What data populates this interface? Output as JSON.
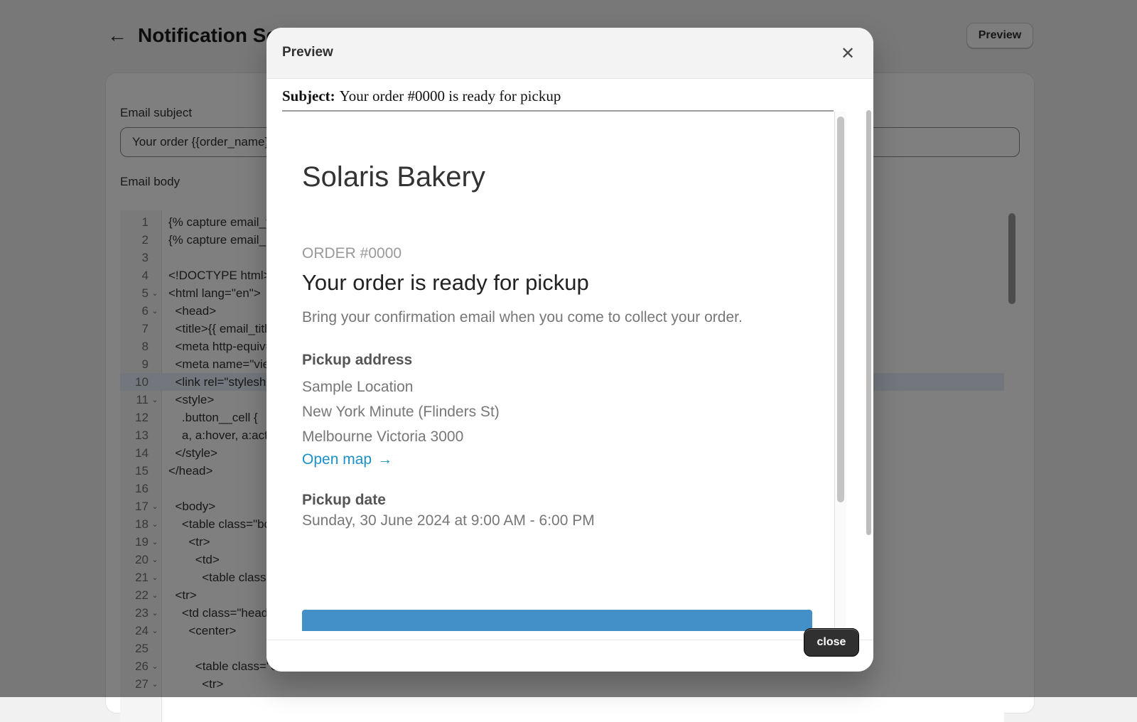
{
  "page": {
    "title": "Notification Settings",
    "preview_label": "Preview",
    "subject_label": "Email subject",
    "subject_value": "Your order {{order_name}} is ready for pickup",
    "body_label": "Email body"
  },
  "code_lines": [
    {
      "n": "1",
      "fold": "",
      "text": "{% capture email_title %}"
    },
    {
      "n": "2",
      "fold": "",
      "text": "{% capture email_body %}"
    },
    {
      "n": "3",
      "fold": "",
      "text": ""
    },
    {
      "n": "4",
      "fold": "",
      "text": "<!DOCTYPE html>"
    },
    {
      "n": "5",
      "fold": "⌄",
      "text": "<html lang=\"en\">"
    },
    {
      "n": "6",
      "fold": "⌄",
      "text": "  <head>"
    },
    {
      "n": "7",
      "fold": "",
      "text": "  <title>{{ email_title }}</title>"
    },
    {
      "n": "8",
      "fold": "",
      "text": "  <meta http-equiv=\"Content-Type\">"
    },
    {
      "n": "9",
      "fold": "",
      "text": "  <meta name=\"viewport\">"
    },
    {
      "n": "10",
      "fold": "",
      "text": "  <link rel=\"stylesheet\">"
    },
    {
      "n": "11",
      "fold": "⌄",
      "text": "  <style>"
    },
    {
      "n": "12",
      "fold": "",
      "text": "    .button__cell {"
    },
    {
      "n": "13",
      "fold": "",
      "text": "    a, a:hover, a:active"
    },
    {
      "n": "14",
      "fold": "",
      "text": "  </style>"
    },
    {
      "n": "15",
      "fold": "",
      "text": "</head>"
    },
    {
      "n": "16",
      "fold": "",
      "text": ""
    },
    {
      "n": "17",
      "fold": "⌄",
      "text": "  <body>"
    },
    {
      "n": "18",
      "fold": "⌄",
      "text": "    <table class=\"body\">"
    },
    {
      "n": "19",
      "fold": "⌄",
      "text": "      <tr>"
    },
    {
      "n": "20",
      "fold": "⌄",
      "text": "        <td>"
    },
    {
      "n": "21",
      "fold": "⌄",
      "text": "          <table class=\"header\">"
    },
    {
      "n": "22",
      "fold": "⌄",
      "text": "  <tr>"
    },
    {
      "n": "23",
      "fold": "⌄",
      "text": "    <td class=\"header__cell\">"
    },
    {
      "n": "24",
      "fold": "⌄",
      "text": "      <center>"
    },
    {
      "n": "25",
      "fold": "",
      "text": ""
    },
    {
      "n": "26",
      "fold": "⌄",
      "text": "        <table class=\"container\">"
    },
    {
      "n": "27",
      "fold": "⌄",
      "text": "          <tr>"
    }
  ],
  "modal": {
    "title": "Preview",
    "close_label": "close",
    "subject_prefix": "Subject:",
    "subject_text": "Your order #0000 is ready for pickup",
    "shop_name": "Solaris Bakery",
    "order_number": "ORDER #0000",
    "heading": "Your order is ready for pickup",
    "message": "Bring your confirmation email when you come to collect your order.",
    "pickup_address_heading": "Pickup address",
    "address": [
      "Sample Location",
      "New York Minute (Flinders St)",
      "Melbourne Victoria 3000"
    ],
    "open_map_label": "Open map",
    "pickup_date_heading": "Pickup date",
    "pickup_date": "Sunday, 30 June 2024 at 9:00 AM - 6:00 PM"
  },
  "colors": {
    "link": "#1990c6",
    "button_dark": "#303030",
    "cta": "#4390c8"
  }
}
